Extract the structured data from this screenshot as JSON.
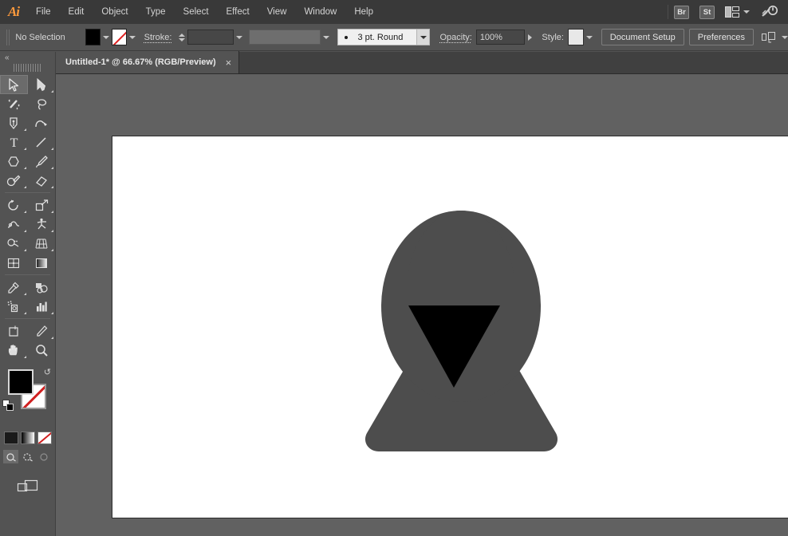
{
  "app": {
    "name": "Adobe Illustrator",
    "logo_text": "Ai"
  },
  "menubar": {
    "items": [
      {
        "label": "File"
      },
      {
        "label": "Edit"
      },
      {
        "label": "Object"
      },
      {
        "label": "Type"
      },
      {
        "label": "Select"
      },
      {
        "label": "Effect"
      },
      {
        "label": "View"
      },
      {
        "label": "Window"
      },
      {
        "label": "Help"
      }
    ],
    "right": {
      "bridge_label": "Br",
      "stock_label": "St",
      "arrange_icon": "arrange-documents-icon",
      "arrange_chevron": "chevron-down-icon",
      "search_icon": "search-adobe-stock-icon"
    }
  },
  "controlbar": {
    "selection_status": "No Selection",
    "fill_swatch_color": "#000000",
    "fill_chevron": "chevron-down-icon",
    "stroke_swatch_color": "none",
    "stroke_chevron": "chevron-down-icon",
    "stroke_label": "Stroke:",
    "stroke_weight_value": "",
    "stroke_weight_chevron": "chevron-down-icon",
    "variable_width_value": "",
    "variable_width_chevron": "chevron-down-icon",
    "brush_definition": "3 pt. Round",
    "brush_chevron": "chevron-down-icon",
    "opacity_label": "Opacity:",
    "opacity_value": "100%",
    "opacity_arrow": "arrow-right-icon",
    "style_label": "Style:",
    "style_swatch_color": "#e8e8e8",
    "style_chevron": "chevron-down-icon",
    "document_setup_label": "Document Setup",
    "preferences_label": "Preferences",
    "align_icon": "align-to-artboard-icon",
    "align_chevron": "chevron-down-icon"
  },
  "tabbar": {
    "tabs": [
      {
        "title": "Untitled-1* @ 66.67% (RGB/Preview)",
        "close": "×",
        "active": true
      }
    ]
  },
  "toolbar": {
    "collapse_icon": "double-chevron-left-icon",
    "grip": "panel-grip-icon",
    "tools": [
      {
        "name": "selection-tool",
        "icon": "selection-arrow-icon",
        "active": true,
        "more": false
      },
      {
        "name": "direct-selection-tool",
        "icon": "direct-selection-arrow-icon",
        "active": false,
        "more": true
      },
      {
        "name": "magic-wand-tool",
        "icon": "magic-wand-icon",
        "active": false,
        "more": false
      },
      {
        "name": "lasso-tool",
        "icon": "lasso-icon",
        "active": false,
        "more": false
      },
      {
        "name": "pen-tool",
        "icon": "pen-nib-icon",
        "active": false,
        "more": true
      },
      {
        "name": "curvature-tool",
        "icon": "curvature-icon",
        "active": false,
        "more": false
      },
      {
        "name": "type-tool",
        "icon": "type-t-icon",
        "active": false,
        "more": true
      },
      {
        "name": "line-segment-tool",
        "icon": "line-segment-icon",
        "active": false,
        "more": true
      },
      {
        "name": "shape-tool",
        "icon": "polygon-icon",
        "active": false,
        "more": true
      },
      {
        "name": "paintbrush-tool",
        "icon": "paintbrush-icon",
        "active": false,
        "more": true
      },
      {
        "name": "shaper-pencil-tool",
        "icon": "pencil-icon",
        "active": false,
        "more": true
      },
      {
        "name": "eraser-tool",
        "icon": "eraser-icon",
        "active": false,
        "more": true
      },
      {
        "name": "rotate-tool",
        "icon": "rotate-icon",
        "active": false,
        "more": true
      },
      {
        "name": "scale-tool",
        "icon": "scale-icon",
        "active": false,
        "more": true
      },
      {
        "name": "width-tool",
        "icon": "width-warp-icon",
        "active": false,
        "more": true
      },
      {
        "name": "free-transform-tool",
        "icon": "puppet-warp-icon",
        "active": false,
        "more": true
      },
      {
        "name": "shape-builder-tool",
        "icon": "shape-builder-icon",
        "active": false,
        "more": true
      },
      {
        "name": "perspective-grid-tool",
        "icon": "perspective-grid-icon",
        "active": false,
        "more": true
      },
      {
        "name": "mesh-tool",
        "icon": "mesh-icon",
        "active": false,
        "more": false
      },
      {
        "name": "gradient-tool",
        "icon": "gradient-icon",
        "active": false,
        "more": false
      },
      {
        "name": "eyedropper-tool",
        "icon": "eyedropper-icon",
        "active": false,
        "more": true
      },
      {
        "name": "blend-tool",
        "icon": "blend-icon",
        "active": false,
        "more": false
      },
      {
        "name": "symbol-sprayer-tool",
        "icon": "symbol-sprayer-icon",
        "active": false,
        "more": true
      },
      {
        "name": "column-graph-tool",
        "icon": "bar-graph-icon",
        "active": false,
        "more": true
      },
      {
        "name": "artboard-tool",
        "icon": "artboard-icon",
        "active": false,
        "more": false
      },
      {
        "name": "slice-tool",
        "icon": "slice-knife-icon",
        "active": false,
        "more": true
      },
      {
        "name": "hand-tool",
        "icon": "hand-icon",
        "active": false,
        "more": true
      },
      {
        "name": "zoom-tool",
        "icon": "magnifier-icon",
        "active": false,
        "more": false
      }
    ],
    "fill_color": "#000000",
    "stroke_color": "none",
    "swap_icon": "swap-fill-stroke-icon",
    "default_icon": "default-fill-stroke-icon",
    "color_mode_icon": "color-swatch-icon",
    "gradient_mode_icon": "gradient-swatch-icon",
    "none_mode_icon": "none-swatch-icon",
    "draw_normal_icon": "draw-normal-icon",
    "draw_behind_icon": "draw-behind-icon",
    "draw_inside_icon": "draw-inside-icon",
    "screen_mode_icon": "change-screen-mode-icon"
  },
  "canvas": {
    "background_color": "#616161",
    "artboard_color": "#ffffff",
    "artwork": {
      "name": "hooded-figure-artwork",
      "hood_color": "#4d4d4d",
      "face_color": "#000000"
    }
  }
}
